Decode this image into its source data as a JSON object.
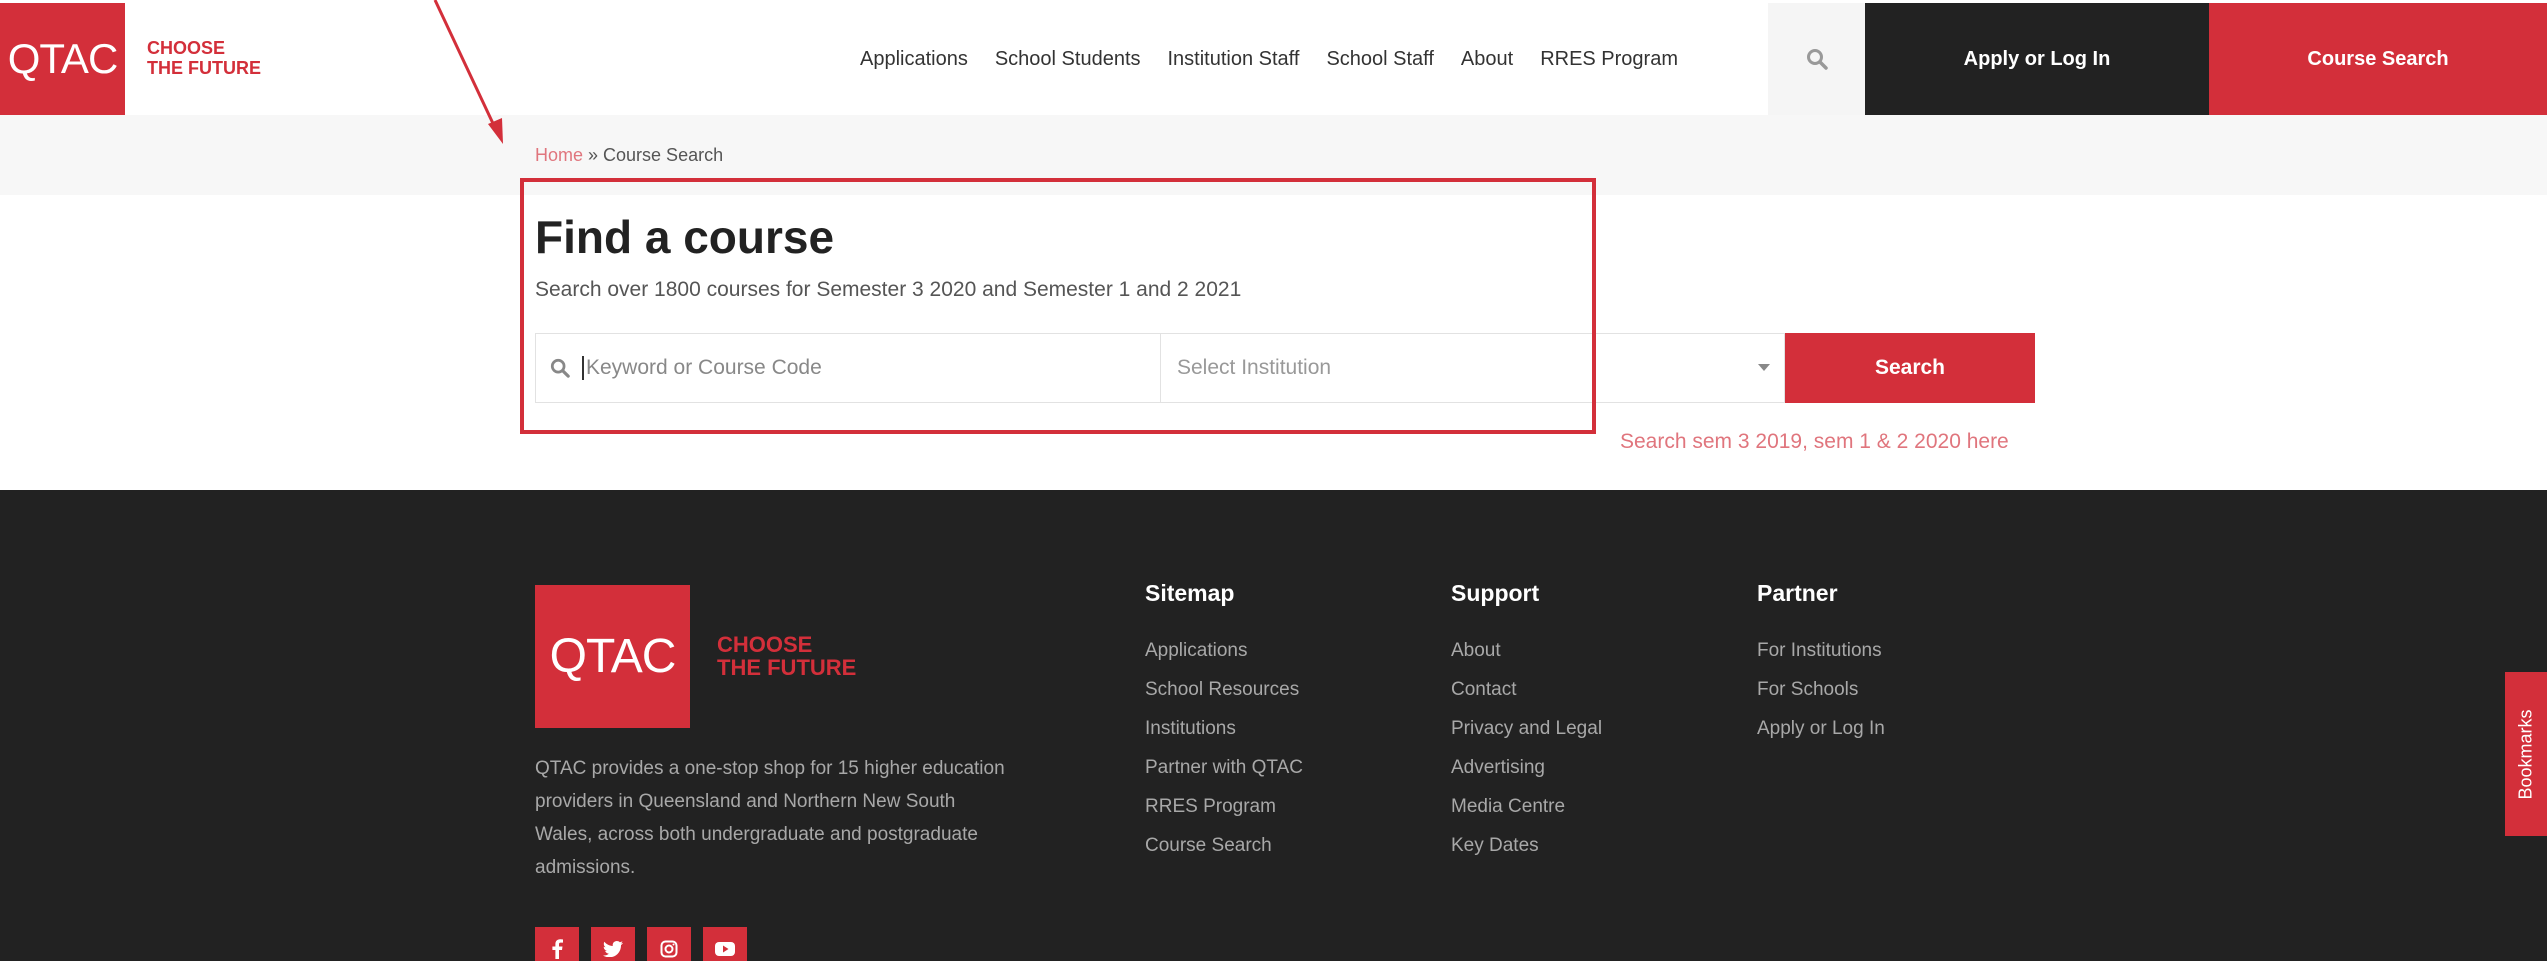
{
  "header": {
    "logo_text": "QTAC",
    "tagline_line1": "CHOOSE",
    "tagline_line2": "THE FUTURE",
    "nav": [
      "Applications",
      "School Students",
      "Institution Staff",
      "School Staff",
      "About",
      "RRES Program"
    ],
    "apply_label": "Apply or Log In",
    "course_search_label": "Course Search"
  },
  "breadcrumb": {
    "home": "Home",
    "separator": " » ",
    "current": "Course Search"
  },
  "main": {
    "title": "Find a course",
    "subtitle": "Search over 1800 courses for Semester 3 2020 and Semester 1 and 2 2021",
    "keyword_placeholder": "Keyword or Course Code",
    "institution_placeholder": "Select Institution",
    "search_label": "Search",
    "old_search_link": "Search sem 3 2019, sem 1 & 2 2020 here"
  },
  "footer": {
    "logo_text": "QTAC",
    "tagline_line1": "CHOOSE",
    "tagline_line2": "THE FUTURE",
    "description": "QTAC provides a one-stop shop for 15 higher education providers in Queensland and Northern New South Wales, across both undergraduate and postgraduate admissions.",
    "sitemap": {
      "title": "Sitemap",
      "links": [
        "Applications",
        "School Resources",
        "Institutions",
        "Partner with QTAC",
        "RRES Program",
        "Course Search"
      ]
    },
    "support": {
      "title": "Support",
      "links": [
        "About",
        "Contact",
        "Privacy and Legal",
        "Advertising",
        "Media Centre",
        "Key Dates"
      ]
    },
    "partner": {
      "title": "Partner",
      "links": [
        "For Institutions",
        "For Schools",
        "Apply or Log In"
      ]
    },
    "social_icons": [
      "facebook-icon",
      "twitter-icon",
      "instagram-icon",
      "youtube-icon"
    ]
  },
  "bookmarks_label": "Bookmarks",
  "colors": {
    "brand_red": "#d32f3a",
    "dark": "#222222",
    "link_pink": "#e0757d"
  }
}
